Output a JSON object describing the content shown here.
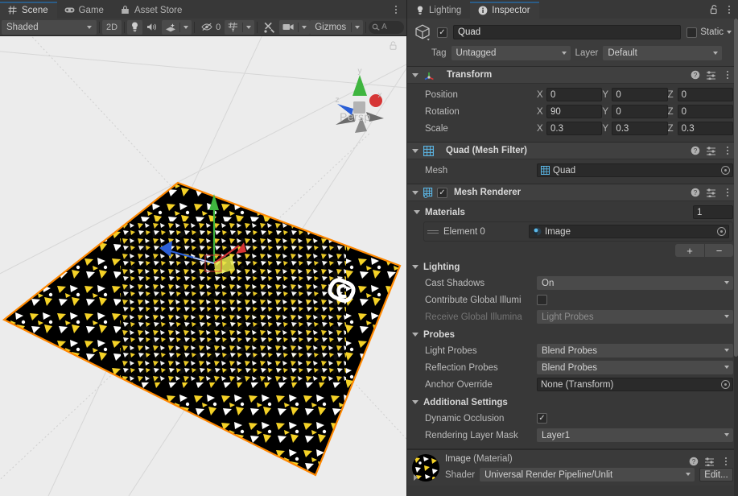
{
  "scene_panel": {
    "tabs": [
      {
        "label": "Scene",
        "icon": "grid-icon",
        "active": true
      },
      {
        "label": "Game",
        "icon": "gamepad-icon",
        "active": false
      },
      {
        "label": "Asset Store",
        "icon": "store-icon",
        "active": false
      }
    ],
    "toolbar": {
      "draw_mode": "Shaded",
      "mode_2d": "2D",
      "lighting_icon": "lightbulb-icon",
      "audio_icon": "speaker-icon",
      "fx_icon": "effects-icon",
      "hidden_count": "0",
      "hidden_icon": "eye-off-icon",
      "grid_icon": "grid-snap-icon",
      "tools_icon": "tools-icon",
      "camera_icon": "camera-icon",
      "gizmos_label": "Gizmos",
      "search_placeholder": "A",
      "search_icon": "search-icon"
    },
    "viewport": {
      "projection_label": "Persp",
      "axis_labels": {
        "x": "x",
        "y": "y",
        "z": "z"
      },
      "lock_icon": "lock-icon",
      "selection_outline_color": "#ff8800",
      "background_color": "#ececec",
      "texture_background": "#000000",
      "texture_colors": [
        "#f5d227",
        "#ffffff"
      ],
      "overlay_glyph": "S",
      "gizmo_axis_colors": {
        "x": "#d63636",
        "y": "#3fb53f",
        "z": "#2b5fd6"
      }
    }
  },
  "inspector_panel": {
    "tabs": [
      {
        "label": "Lighting",
        "icon": "lightbulb-icon",
        "active": false
      },
      {
        "label": "Inspector",
        "icon": "info-icon",
        "active": true
      }
    ],
    "lock_icon": "unlock-icon",
    "menu_icon": "kebab-icon",
    "header": {
      "object_icon": "cube-icon",
      "enabled": true,
      "name": "Quad",
      "static_label": "Static",
      "static_checked": false,
      "tag_label": "Tag",
      "tag_value": "Untagged",
      "layer_label": "Layer",
      "layer_value": "Default"
    },
    "components": [
      {
        "title": "Transform",
        "icon": "transform-icon",
        "help_icon": "help-icon",
        "preset_icon": "preset-icon",
        "menu_icon": "kebab-icon",
        "rows": [
          {
            "label": "Position",
            "x": "0",
            "y": "0",
            "z": "0"
          },
          {
            "label": "Rotation",
            "x": "90",
            "y": "0",
            "z": "0"
          },
          {
            "label": "Scale",
            "x": "0.3",
            "y": "0.3",
            "z": "0.3"
          }
        ],
        "axis_labels": [
          "X",
          "Y",
          "Z"
        ]
      },
      {
        "title": "Quad (Mesh Filter)",
        "icon": "mesh-filter-icon",
        "mesh_label": "Mesh",
        "mesh_value": "Quad",
        "mesh_value_icon": "mesh-icon"
      },
      {
        "title": "Mesh Renderer",
        "icon": "mesh-renderer-icon",
        "enabled": true,
        "materials": {
          "label": "Materials",
          "count": "1",
          "element_label": "Element 0",
          "element_value": "Image",
          "element_icon": "material-icon",
          "add_label": "+",
          "remove_label": "−"
        },
        "lighting": {
          "label": "Lighting",
          "cast_shadows_label": "Cast Shadows",
          "cast_shadows_value": "On",
          "contribute_gi_label": "Contribute Global Illumi",
          "contribute_gi_checked": false,
          "receive_gi_label": "Receive Global Illumina",
          "receive_gi_value": "Light Probes"
        },
        "probes": {
          "label": "Probes",
          "light_probes_label": "Light Probes",
          "light_probes_value": "Blend Probes",
          "reflection_probes_label": "Reflection Probes",
          "reflection_probes_value": "Blend Probes",
          "anchor_override_label": "Anchor Override",
          "anchor_override_value": "None (Transform)"
        },
        "additional": {
          "label": "Additional Settings",
          "dynamic_occlusion_label": "Dynamic Occlusion",
          "dynamic_occlusion_checked": true,
          "rendering_layer_mask_label": "Rendering Layer Mask",
          "rendering_layer_mask_value": "Layer1"
        }
      }
    ],
    "material_footer": {
      "name": "Image",
      "type": "(Material)",
      "shader_label": "Shader",
      "shader_value": "Universal Render Pipeline/Unlit",
      "edit_label": "Edit...",
      "help_icon": "help-icon",
      "preset_icon": "preset-icon",
      "menu_icon": "kebab-icon"
    }
  }
}
